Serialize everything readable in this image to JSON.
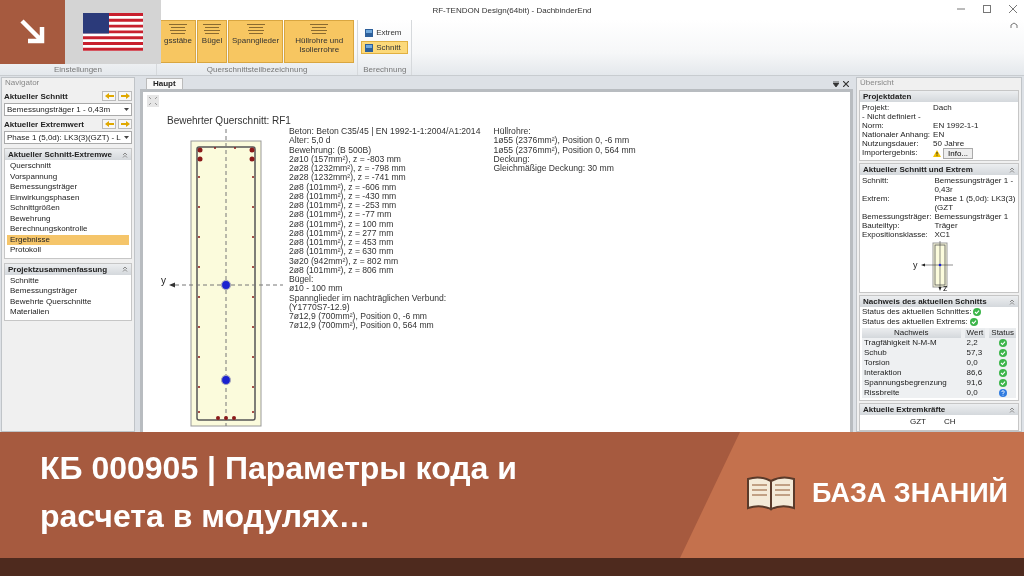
{
  "window": {
    "title": "RF-TENDON Design(64bit) - DachbinderEnd"
  },
  "ribbon": {
    "settings_group": "Einstellungen",
    "section_group": {
      "label": "Querschnittsteilbezeichnung",
      "buttons": [
        {
          "label": "gsstäbe"
        },
        {
          "label": "Bügel"
        },
        {
          "label": "Spannglieder"
        },
        {
          "label": "Hüllrohre und Isolierrohre"
        }
      ]
    },
    "calc_group": {
      "label": "Berechnung",
      "options": [
        {
          "label": "Extrem",
          "selected": false
        },
        {
          "label": "Schnitt",
          "selected": true
        }
      ]
    }
  },
  "navigator": {
    "title": "Navigator",
    "section_label": "Aktueller Schnitt",
    "section_value": "Bemessungsträger 1 - 0,43m",
    "extreme_label": "Aktueller Extremwert",
    "extreme_value": "Phase 1 (5,0d): LK3(3)(GZT) - L",
    "groups": [
      {
        "title": "Aktueller Schnitt-Extremwe",
        "items": [
          {
            "label": "Querschnitt",
            "selected": false
          },
          {
            "label": "Vorspannung",
            "selected": false
          },
          {
            "label": "Bemessungsträger",
            "selected": false
          },
          {
            "label": "Einwirkungsphasen",
            "selected": false
          },
          {
            "label": "Schnittgrößen",
            "selected": false
          },
          {
            "label": "Bewehrung",
            "selected": false
          },
          {
            "label": "Berechnungskontrolle",
            "selected": false
          },
          {
            "label": "Ergebnisse",
            "selected": true
          },
          {
            "label": "Protokoll",
            "selected": false
          }
        ]
      },
      {
        "title": "Projektzusammenfassung",
        "items": [
          {
            "label": "Schnitte",
            "selected": false
          },
          {
            "label": "Bemessungsträger",
            "selected": false
          },
          {
            "label": "Bewehrte Querschnitte",
            "selected": false
          },
          {
            "label": "Materialien",
            "selected": false
          }
        ]
      }
    ]
  },
  "main": {
    "tab": "Haupt",
    "title": "Bewehrter Querschnitt: RF1",
    "axis_label": "y",
    "column_1": [
      "Beton: Beton C35/45 | EN 1992-1-1:2004/A1:2014",
      "Alter: 5,0 d",
      "Bewehrung: (B 500B)",
      "2ø10 (157mm²), z = -803 mm",
      "2ø28 (1232mm²), z = -798 mm",
      "2ø28 (1232mm²), z = -741 mm",
      "2ø8 (101mm²), z = -606 mm",
      "2ø8 (101mm²), z = -430 mm",
      "2ø8 (101mm²), z = -253 mm",
      "2ø8 (101mm²), z = -77 mm",
      "2ø8 (101mm²), z = 100 mm",
      "2ø8 (101mm²), z = 277 mm",
      "2ø8 (101mm²), z = 453 mm",
      "2ø8 (101mm²), z = 630 mm",
      "3ø20 (942mm²), z = 802 mm",
      "2ø8 (101mm²), z = 806 mm",
      "Bügel:",
      "ø10 - 100 mm",
      "Spannglieder im nachträglichen Verbund:",
      "(Y1770S7-12.9)",
      "7ø12,9 (700mm²), Position 0, -6 mm",
      "7ø12,9 (700mm²), Position 0, 564 mm"
    ],
    "column_2": [
      "Hüllrohre:",
      "1ø55 (2376mm²), Position 0, -6 mm",
      "1ø55 (2376mm²), Position 0, 564 mm",
      "Deckung:",
      "Gleichmäßige Deckung: 30 mm"
    ]
  },
  "overview": {
    "title": "Übersicht",
    "project": {
      "title": "Projektdaten",
      "rows": [
        {
          "label": "Projekt:",
          "value": "Dach"
        },
        {
          "label": "- Nicht definiert -"
        },
        {
          "label": "Norm:",
          "value": "EN 1992-1-1"
        },
        {
          "label": "Nationaler Anhang:",
          "value": "EN"
        },
        {
          "label": "Nutzungsdauer:",
          "value": "50 Jahre"
        }
      ],
      "import_label": "Importergebnis:",
      "import_button": "Info..."
    },
    "current": {
      "title": "Aktueller Schnitt und Extrem",
      "rows": [
        {
          "label": "Schnitt:",
          "value": "Bemessungsträger 1 - 0,43r"
        },
        {
          "label": "Extrem:",
          "value": "Phase 1 (5,0d): LK3(3)(GZT"
        },
        {
          "label": "Bemessungsträger:",
          "value": "Bemessungsträger 1"
        },
        {
          "label": "Bauteiltyp:",
          "value": "Träger"
        },
        {
          "label": "Expositionsklasse:",
          "value": "XC1"
        }
      ],
      "axis_y": "y",
      "axis_z": "z"
    },
    "check": {
      "title": "Nachweis des aktuellen Schnitts",
      "statuses": [
        {
          "label": "Status des aktuellen Schnittes:",
          "kind": "ok"
        },
        {
          "label": "Status des aktuellen Extrems:",
          "kind": "ok"
        }
      ],
      "columns": [
        "Nachweis",
        "Wert",
        "Status"
      ],
      "rows": [
        {
          "name": "Tragfähigkeit N-M-M",
          "value": "2,2",
          "kind": "ok"
        },
        {
          "name": "Schub",
          "value": "57,3",
          "kind": "ok"
        },
        {
          "name": "Torsion",
          "value": "0,0",
          "kind": "ok"
        },
        {
          "name": "Interaktion",
          "value": "86,6",
          "kind": "ok"
        },
        {
          "name": "Spannungsbegrenzung",
          "value": "91,6",
          "kind": "ok"
        },
        {
          "name": "Rissbreite",
          "value": "0,0",
          "kind": "info"
        }
      ]
    },
    "forces": {
      "title": "Aktuelle Extremkräfte",
      "columns": [
        "GZT",
        "CH"
      ]
    }
  },
  "banner": {
    "title": "КБ 000905 | Параметры кода и расчета в модулях…",
    "label": "БАЗА ЗНАНИЙ"
  }
}
